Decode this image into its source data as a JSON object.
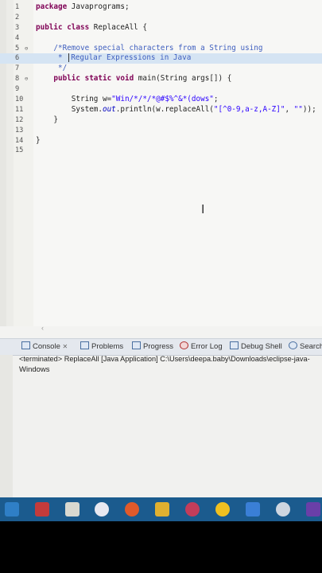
{
  "editor": {
    "lines": [
      {
        "n": "1",
        "code": "package Javaprograms;"
      },
      {
        "n": "2",
        "code": ""
      },
      {
        "n": "3",
        "code": "public class ReplaceAll {"
      },
      {
        "n": "4",
        "code": ""
      },
      {
        "n": "5",
        "code": "    /*Remove special characters from a String using"
      },
      {
        "n": "6",
        "code": "     * |Regular Expressions in Java"
      },
      {
        "n": "7",
        "code": "     */"
      },
      {
        "n": "8",
        "code": "    public static void main(String args[]) {"
      },
      {
        "n": "9",
        "code": ""
      },
      {
        "n": "10",
        "code": "        String w=\"Win/*/*/*@#$%^&*(dows\";"
      },
      {
        "n": "11",
        "code": "        System.out.println(w.replaceAll(\"[^0-9,a-z,A-Z]\", \"\"));"
      },
      {
        "n": "12",
        "code": "    }"
      },
      {
        "n": "13",
        "code": ""
      },
      {
        "n": "14",
        "code": "}"
      },
      {
        "n": "15",
        "code": ""
      }
    ],
    "markers": {
      "5": "⊖",
      "8": "⊖"
    }
  },
  "console": {
    "tabs": [
      "Console",
      "Problems",
      "Progress",
      "Error Log",
      "Debug Shell",
      "Search"
    ],
    "tab_close": "✕",
    "status_line": "<terminated> ReplaceAll [Java Application] C:\\Users\\deepa.baby\\Downloads\\eclipse-java-",
    "output": "Windows"
  },
  "colors": {
    "taskbar": "#1b5b8e",
    "keyword": "#7f0055",
    "comment": "#3f5fbf",
    "string": "#2a00ff"
  },
  "taskbar_icons": [
    "start-icon",
    "chrome-pin-icon",
    "folder-icon",
    "media-icon",
    "block-icon",
    "paint-icon",
    "app-icon",
    "photo-icon",
    "chrome-icon",
    "shield-icon",
    "cloud-icon",
    "visual-studio-icon"
  ]
}
